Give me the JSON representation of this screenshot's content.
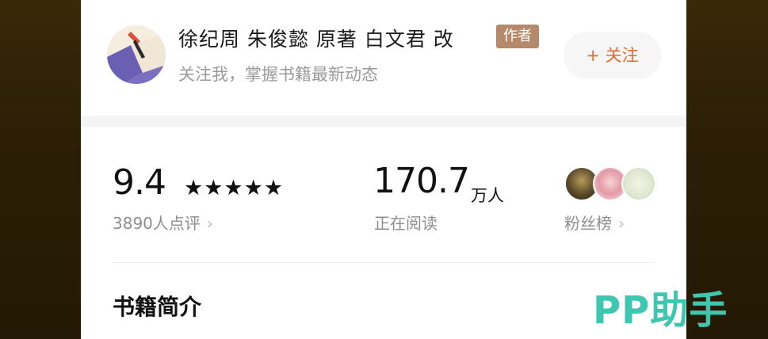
{
  "author": {
    "name": "徐纪周 朱俊懿 原著  白文君 改",
    "badge": "作者",
    "subtitle": "关注我，掌握书籍最新动态",
    "follow_label": "+ 关注"
  },
  "rating": {
    "score": "9.4",
    "stars": "★★★★★",
    "reviews": "3890人点评"
  },
  "readers": {
    "count": "170.7",
    "unit": "万人",
    "label": "正在阅读"
  },
  "fans": {
    "label": "粉丝榜"
  },
  "section": {
    "title": "书籍简介"
  },
  "watermark": "PP助手",
  "colors": {
    "accent": "#e36b2c",
    "badge": "#b58a6a",
    "watermark": "#3ec7b0"
  }
}
